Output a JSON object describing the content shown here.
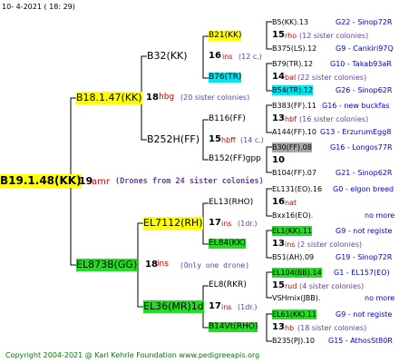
{
  "header": {
    "date": "10-   4-2021  (  18:  29)"
  },
  "footer": {
    "copyright": "Copyright 2004-2021 @ Karl Kehrle Foundation    www.pedigreeapis.org"
  },
  "root": {
    "id": "B19.1.48(KK)",
    "gen": "19",
    "notes": "amr",
    "remark": "(Drones from 24 sister colonies)"
  },
  "mother": {
    "id": "B18.1.47(KK)",
    "gen": "18",
    "notes": "hbg",
    "remark": "(20 sister colonies)"
  },
  "father": {
    "id": "EL873B(GG)",
    "gen": "18",
    "notes": "ins",
    "remark": "(Only one drone)"
  },
  "g2": [
    {
      "id": "B32(KK)",
      "gen": "",
      "notes": "",
      "remark": ""
    },
    {
      "id": "B252H(FF)",
      "gen": "15",
      "notes": "hbff",
      "remark": "(14 c.)"
    },
    {
      "id": "EL7112(RH)",
      "gen": "17",
      "notes": "ins",
      "remark": "(1dr.)"
    },
    {
      "id": "EL36(MR)1d",
      "gen": "17",
      "notes": "ins",
      "remark": "(1dr.)"
    }
  ],
  "g3": [
    {
      "id": "B21(KK)",
      "gen": "16",
      "notes": "ins",
      "remark": "(12 c.)"
    },
    {
      "id": "B76(TR)",
      "gen": "",
      "notes": "",
      "remark": ""
    },
    {
      "id": "B116(FF)",
      "gen": "",
      "notes": "",
      "remark": ""
    },
    {
      "id": "B152(FF)gpp",
      "gen": "",
      "notes": "",
      "remark": ""
    },
    {
      "id": "EL13(RHO)",
      "gen": "",
      "notes": "",
      "remark": ""
    },
    {
      "id": "EL84(KK)",
      "gen": "",
      "notes": "",
      "remark": ""
    },
    {
      "id": "EL8(RKR)",
      "gen": "",
      "notes": "",
      "remark": ""
    },
    {
      "id": "B14Vt(RHO)",
      "gen": "",
      "notes": "",
      "remark": ""
    }
  ],
  "g4": [
    {
      "id": "B5(KK).13",
      "origin": "G22 - Sinop72R",
      "gen": "15",
      "notes": "rho",
      "remark": "(12 sister colonies)",
      "id2": "B375(LS).12",
      "origin2": "G9 - Cankiri97Q"
    },
    {
      "id": "B79(TR).12",
      "origin": "G10 - Takab93aR",
      "gen": "14",
      "notes": "bal",
      "remark": "(22 sister colonies)",
      "id2": "B54(TR).12",
      "origin2": "G26 - Sinop62R"
    },
    {
      "id": "B383(FF).11",
      "origin": "G16 - new buckfas",
      "gen": "13",
      "notes": "hbf",
      "remark": "(16 sister colonies)",
      "id2": "A144(FF).10",
      "origin2": "G13 - ErzurumEgg8"
    },
    {
      "id": "B30(FF).08",
      "origin": "G16 - Longos77R",
      "gen": "10",
      "notes": "",
      "remark": "",
      "id2": "B104(FF).07",
      "origin2": "G21 - Sinop62R"
    },
    {
      "id": "EL131(EO).16",
      "origin": "G0 - elgon breed",
      "gen": "16",
      "notes": "nat",
      "remark": "",
      "id2": "Bxx16(EO).",
      "origin2": "no more"
    },
    {
      "id": "EL1(KK).11",
      "origin": "G9 - not registe",
      "gen": "13",
      "notes": "ins",
      "remark": "(2 sister colonies)",
      "id2": "B51(AH).09",
      "origin2": "G19 - Sinop72R"
    },
    {
      "id": "EL104(BB).14",
      "origin": "G1 - EL157(EO)",
      "gen": "15",
      "notes": "rud",
      "remark": "(4 sister colonies)",
      "id2": "VSHmix(JBB).",
      "origin2": "no more"
    },
    {
      "id": "EL61(KK).11",
      "origin": "G9 - not registe",
      "gen": "13",
      "notes": "hb",
      "remark": "(18 sister colonies)",
      "id2": "B235(PJ).10",
      "origin2": "G15 - AthosSt80R"
    }
  ]
}
